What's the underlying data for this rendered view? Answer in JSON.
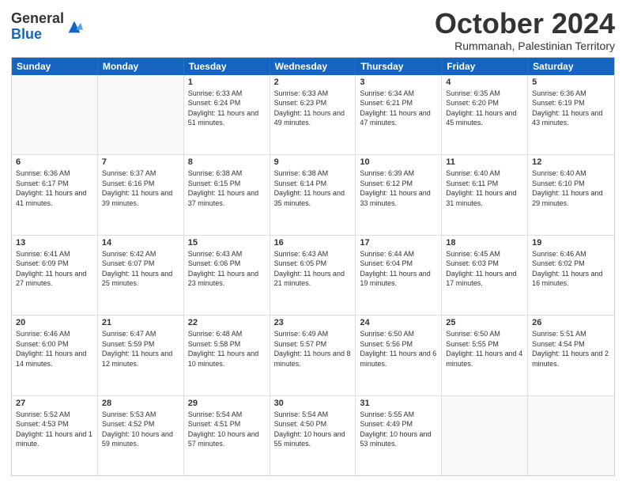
{
  "logo": {
    "general": "General",
    "blue": "Blue"
  },
  "header": {
    "month": "October 2024",
    "location": "Rummanah, Palestinian Territory"
  },
  "weekdays": [
    "Sunday",
    "Monday",
    "Tuesday",
    "Wednesday",
    "Thursday",
    "Friday",
    "Saturday"
  ],
  "weeks": [
    [
      {
        "day": "",
        "sunrise": "",
        "sunset": "",
        "daylight": ""
      },
      {
        "day": "",
        "sunrise": "",
        "sunset": "",
        "daylight": ""
      },
      {
        "day": "1",
        "sunrise": "Sunrise: 6:33 AM",
        "sunset": "Sunset: 6:24 PM",
        "daylight": "Daylight: 11 hours and 51 minutes."
      },
      {
        "day": "2",
        "sunrise": "Sunrise: 6:33 AM",
        "sunset": "Sunset: 6:23 PM",
        "daylight": "Daylight: 11 hours and 49 minutes."
      },
      {
        "day": "3",
        "sunrise": "Sunrise: 6:34 AM",
        "sunset": "Sunset: 6:21 PM",
        "daylight": "Daylight: 11 hours and 47 minutes."
      },
      {
        "day": "4",
        "sunrise": "Sunrise: 6:35 AM",
        "sunset": "Sunset: 6:20 PM",
        "daylight": "Daylight: 11 hours and 45 minutes."
      },
      {
        "day": "5",
        "sunrise": "Sunrise: 6:36 AM",
        "sunset": "Sunset: 6:19 PM",
        "daylight": "Daylight: 11 hours and 43 minutes."
      }
    ],
    [
      {
        "day": "6",
        "sunrise": "Sunrise: 6:36 AM",
        "sunset": "Sunset: 6:17 PM",
        "daylight": "Daylight: 11 hours and 41 minutes."
      },
      {
        "day": "7",
        "sunrise": "Sunrise: 6:37 AM",
        "sunset": "Sunset: 6:16 PM",
        "daylight": "Daylight: 11 hours and 39 minutes."
      },
      {
        "day": "8",
        "sunrise": "Sunrise: 6:38 AM",
        "sunset": "Sunset: 6:15 PM",
        "daylight": "Daylight: 11 hours and 37 minutes."
      },
      {
        "day": "9",
        "sunrise": "Sunrise: 6:38 AM",
        "sunset": "Sunset: 6:14 PM",
        "daylight": "Daylight: 11 hours and 35 minutes."
      },
      {
        "day": "10",
        "sunrise": "Sunrise: 6:39 AM",
        "sunset": "Sunset: 6:12 PM",
        "daylight": "Daylight: 11 hours and 33 minutes."
      },
      {
        "day": "11",
        "sunrise": "Sunrise: 6:40 AM",
        "sunset": "Sunset: 6:11 PM",
        "daylight": "Daylight: 11 hours and 31 minutes."
      },
      {
        "day": "12",
        "sunrise": "Sunrise: 6:40 AM",
        "sunset": "Sunset: 6:10 PM",
        "daylight": "Daylight: 11 hours and 29 minutes."
      }
    ],
    [
      {
        "day": "13",
        "sunrise": "Sunrise: 6:41 AM",
        "sunset": "Sunset: 6:09 PM",
        "daylight": "Daylight: 11 hours and 27 minutes."
      },
      {
        "day": "14",
        "sunrise": "Sunrise: 6:42 AM",
        "sunset": "Sunset: 6:07 PM",
        "daylight": "Daylight: 11 hours and 25 minutes."
      },
      {
        "day": "15",
        "sunrise": "Sunrise: 6:43 AM",
        "sunset": "Sunset: 6:06 PM",
        "daylight": "Daylight: 11 hours and 23 minutes."
      },
      {
        "day": "16",
        "sunrise": "Sunrise: 6:43 AM",
        "sunset": "Sunset: 6:05 PM",
        "daylight": "Daylight: 11 hours and 21 minutes."
      },
      {
        "day": "17",
        "sunrise": "Sunrise: 6:44 AM",
        "sunset": "Sunset: 6:04 PM",
        "daylight": "Daylight: 11 hours and 19 minutes."
      },
      {
        "day": "18",
        "sunrise": "Sunrise: 6:45 AM",
        "sunset": "Sunset: 6:03 PM",
        "daylight": "Daylight: 11 hours and 17 minutes."
      },
      {
        "day": "19",
        "sunrise": "Sunrise: 6:46 AM",
        "sunset": "Sunset: 6:02 PM",
        "daylight": "Daylight: 11 hours and 16 minutes."
      }
    ],
    [
      {
        "day": "20",
        "sunrise": "Sunrise: 6:46 AM",
        "sunset": "Sunset: 6:00 PM",
        "daylight": "Daylight: 11 hours and 14 minutes."
      },
      {
        "day": "21",
        "sunrise": "Sunrise: 6:47 AM",
        "sunset": "Sunset: 5:59 PM",
        "daylight": "Daylight: 11 hours and 12 minutes."
      },
      {
        "day": "22",
        "sunrise": "Sunrise: 6:48 AM",
        "sunset": "Sunset: 5:58 PM",
        "daylight": "Daylight: 11 hours and 10 minutes."
      },
      {
        "day": "23",
        "sunrise": "Sunrise: 6:49 AM",
        "sunset": "Sunset: 5:57 PM",
        "daylight": "Daylight: 11 hours and 8 minutes."
      },
      {
        "day": "24",
        "sunrise": "Sunrise: 6:50 AM",
        "sunset": "Sunset: 5:56 PM",
        "daylight": "Daylight: 11 hours and 6 minutes."
      },
      {
        "day": "25",
        "sunrise": "Sunrise: 6:50 AM",
        "sunset": "Sunset: 5:55 PM",
        "daylight": "Daylight: 11 hours and 4 minutes."
      },
      {
        "day": "26",
        "sunrise": "Sunrise: 5:51 AM",
        "sunset": "Sunset: 4:54 PM",
        "daylight": "Daylight: 11 hours and 2 minutes."
      }
    ],
    [
      {
        "day": "27",
        "sunrise": "Sunrise: 5:52 AM",
        "sunset": "Sunset: 4:53 PM",
        "daylight": "Daylight: 11 hours and 1 minute."
      },
      {
        "day": "28",
        "sunrise": "Sunrise: 5:53 AM",
        "sunset": "Sunset: 4:52 PM",
        "daylight": "Daylight: 10 hours and 59 minutes."
      },
      {
        "day": "29",
        "sunrise": "Sunrise: 5:54 AM",
        "sunset": "Sunset: 4:51 PM",
        "daylight": "Daylight: 10 hours and 57 minutes."
      },
      {
        "day": "30",
        "sunrise": "Sunrise: 5:54 AM",
        "sunset": "Sunset: 4:50 PM",
        "daylight": "Daylight: 10 hours and 55 minutes."
      },
      {
        "day": "31",
        "sunrise": "Sunrise: 5:55 AM",
        "sunset": "Sunset: 4:49 PM",
        "daylight": "Daylight: 10 hours and 53 minutes."
      },
      {
        "day": "",
        "sunrise": "",
        "sunset": "",
        "daylight": ""
      },
      {
        "day": "",
        "sunrise": "",
        "sunset": "",
        "daylight": ""
      }
    ]
  ]
}
